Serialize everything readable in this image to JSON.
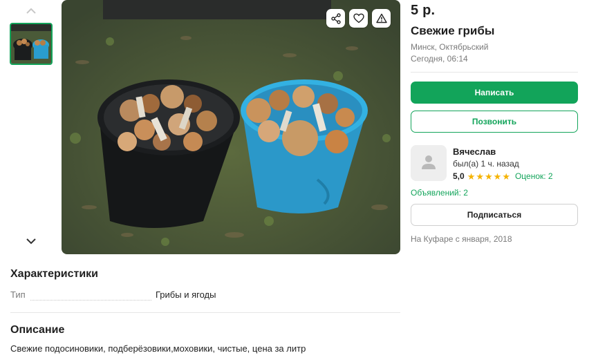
{
  "listing": {
    "price": "5 р.",
    "title": "Свежие грибы",
    "location": "Минск, Октябрьский",
    "posted": "Сегодня, 06:14"
  },
  "actions": {
    "write_label": "Написать",
    "call_label": "Позвонить",
    "subscribe_label": "Подписаться"
  },
  "seller": {
    "name": "Вячеслав",
    "last_seen": "был(а) 1 ч. назад",
    "rating": "5,0",
    "stars": 5,
    "reviews": "Оценок: 2",
    "ads": "Объявлений: 2",
    "since": "На Куфаре с января, 2018"
  },
  "gallery": {
    "icons": [
      "chevron-up-icon",
      "chevron-down-icon",
      "share-icon",
      "heart-icon",
      "warning-icon"
    ],
    "count": 1
  },
  "characteristics": {
    "heading": "Характеристики",
    "items": [
      {
        "key": "Тип",
        "value": "Грибы и ягоды"
      }
    ]
  },
  "description": {
    "heading": "Описание",
    "text": "Свежие подосиновики, подберёзовики,моховики, чистые, цена за литр"
  },
  "colors": {
    "accent": "#12a45a",
    "star": "#f5b300",
    "muted": "#7a7a7a"
  }
}
